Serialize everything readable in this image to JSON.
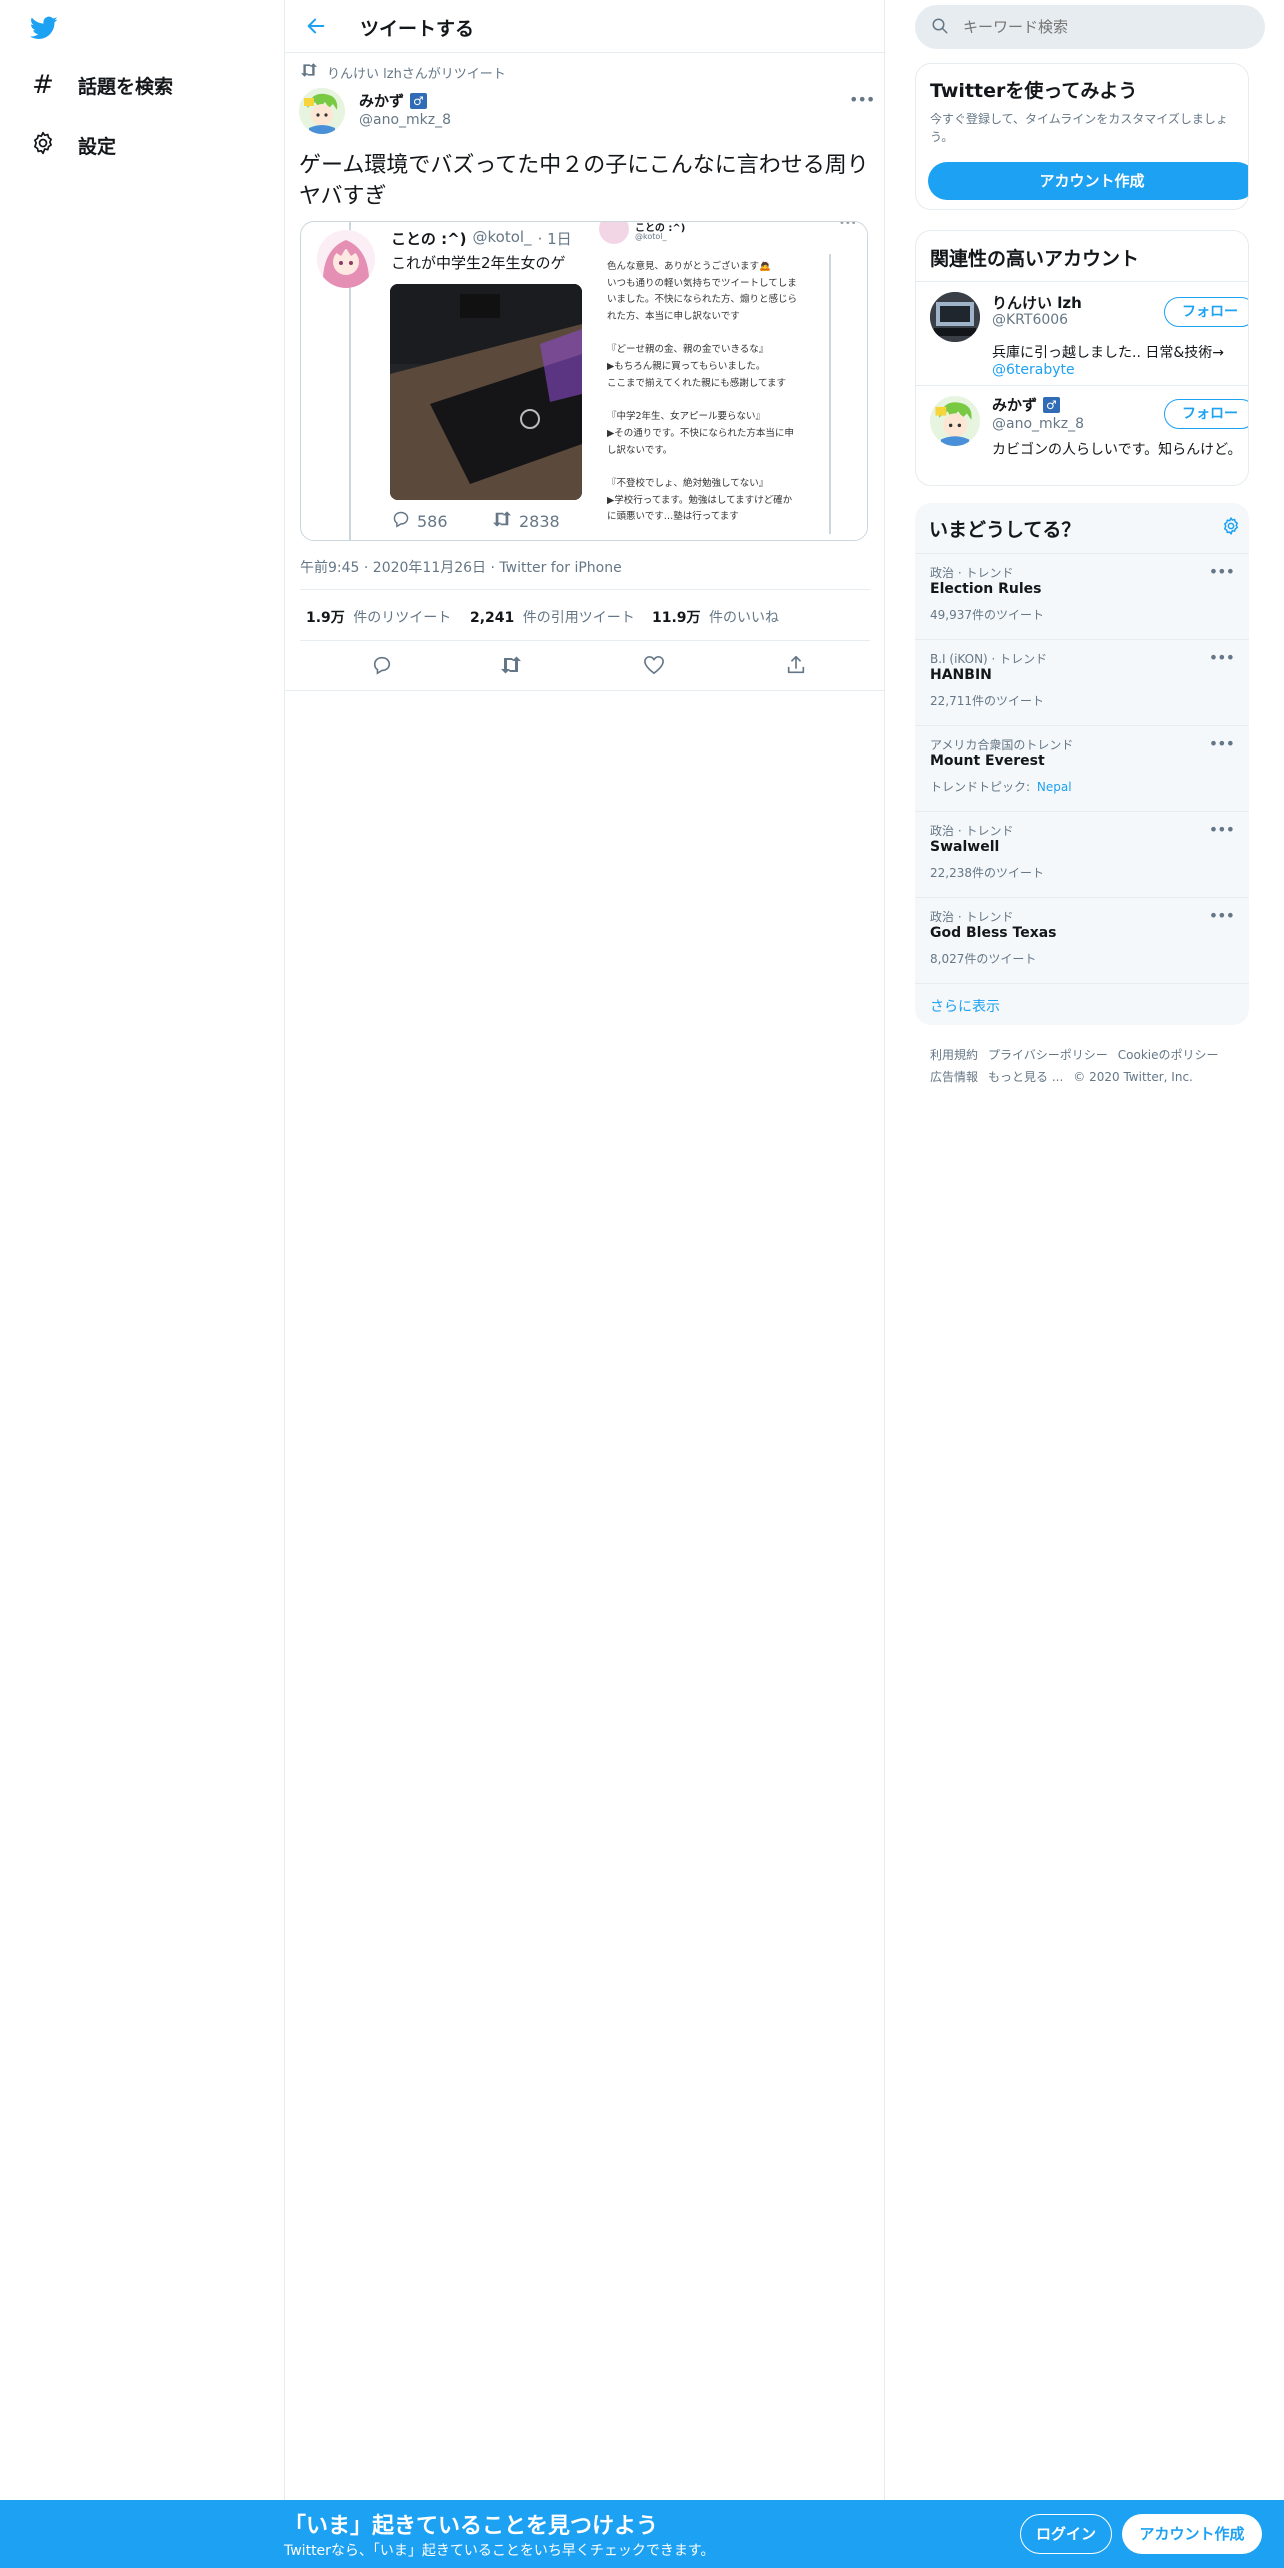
{
  "nav": {
    "explore_label": "話題を検索",
    "settings_label": "設定"
  },
  "header": {
    "title": "ツイートする"
  },
  "tweet": {
    "retweeted_by": "りんけい lzhさんがリツイート",
    "author_name": "みかず",
    "author_badge": "♂",
    "author_handle": "@ano_mkz_8",
    "text": "ゲーム環境でバズってた中２の子にこんなに言わせる周りヤバすぎ",
    "timestamp": "午前9:45 · 2020年11月26日 · Twitter for iPhone",
    "stats": {
      "retweets_value": "1.9万",
      "retweets_label": "件のリツイート",
      "quotes_value": "2,241",
      "quotes_label": "件の引用ツイート",
      "likes_value": "11.9万",
      "likes_label": "件のいいね"
    }
  },
  "quoted": {
    "name": "ことの :^)",
    "handle": "@kotol_",
    "time": "· 1日",
    "text": "これが中学生2年生女のゲ",
    "reply_count": "586",
    "retweet_count": "2838",
    "screenshot": {
      "name": "ことの :^)",
      "handle": "@kotol_",
      "lines": [
        "色んな意見、ありがとうございます🙇",
        "いつも通りの軽い気持ちでツイートしてしま",
        "いました。不快になられた方、煽りと感じら",
        "れた方、本当に申し訳ないです",
        "",
        "『どーせ親の金、親の金でいきるな』",
        "▶もちろん親に買ってもらいました。",
        "ここまで揃えてくれた親にも感謝してます",
        "",
        "『中学2年生、女アピール要らない』",
        "▶その通りです。不快になられた方本当に申",
        "し訳ないです。",
        "",
        "『不登校でしょ、絶対勉強してない』",
        "▶学校行ってます。勉強はしてますけど確か",
        "に頭悪いです…塾は行ってます"
      ]
    }
  },
  "search": {
    "placeholder": "キーワード検索"
  },
  "signup": {
    "title": "Twitterを使ってみよう",
    "desc": "今すぐ登録して、タイムラインをカスタマイズしましょう。",
    "button": "アカウント作成"
  },
  "related": {
    "title": "関連性の高いアカウント",
    "follow_label": "フォロー",
    "accounts": [
      {
        "name": "りんけい lzh",
        "handle": "@KRT6006",
        "bio": "兵庫に引っ越しました.. 日常&技術→",
        "bio_link": "@6terabyte"
      },
      {
        "name": "みかず",
        "badge": "♂",
        "handle": "@ano_mkz_8",
        "bio": "カビゴンの人らしいです。知らんけど。"
      }
    ]
  },
  "trends": {
    "title": "いまどうしてる？",
    "items": [
      {
        "context": "政治 · トレンド",
        "name": "Election Rules",
        "count": "49,937件のツイート"
      },
      {
        "context": "B.I (iKON) · トレンド",
        "name": "HANBIN",
        "count": "22,711件のツイート"
      },
      {
        "context": "アメリカ合衆国のトレンド",
        "name": "Mount Everest",
        "count_prefix": "トレンドトピック:",
        "count_link": "Nepal"
      },
      {
        "context": "政治 · トレンド",
        "name": "Swalwell",
        "count": "22,238件のツイート"
      },
      {
        "context": "政治 · トレンド",
        "name": "God Bless Texas",
        "count": "8,027件のツイート"
      }
    ],
    "show_more": "さらに表示"
  },
  "footer": {
    "links": [
      "利用規約",
      "プライバシーポリシー",
      "Cookieのポリシー",
      "広告情報",
      "もっと見る ..."
    ],
    "copyright": "© 2020 Twitter, Inc."
  },
  "bottom": {
    "headline": "「いま」起きていることを見つけよう",
    "sub": "Twitterなら、「いま」起きていることをいち早くチェックできます。",
    "login": "ログイン",
    "signup": "アカウント作成"
  },
  "colors": {
    "brand": "#1da1f2",
    "text_secondary": "#657786",
    "border": "#e6ecf0",
    "panel_bg": "#f5f8fa"
  }
}
